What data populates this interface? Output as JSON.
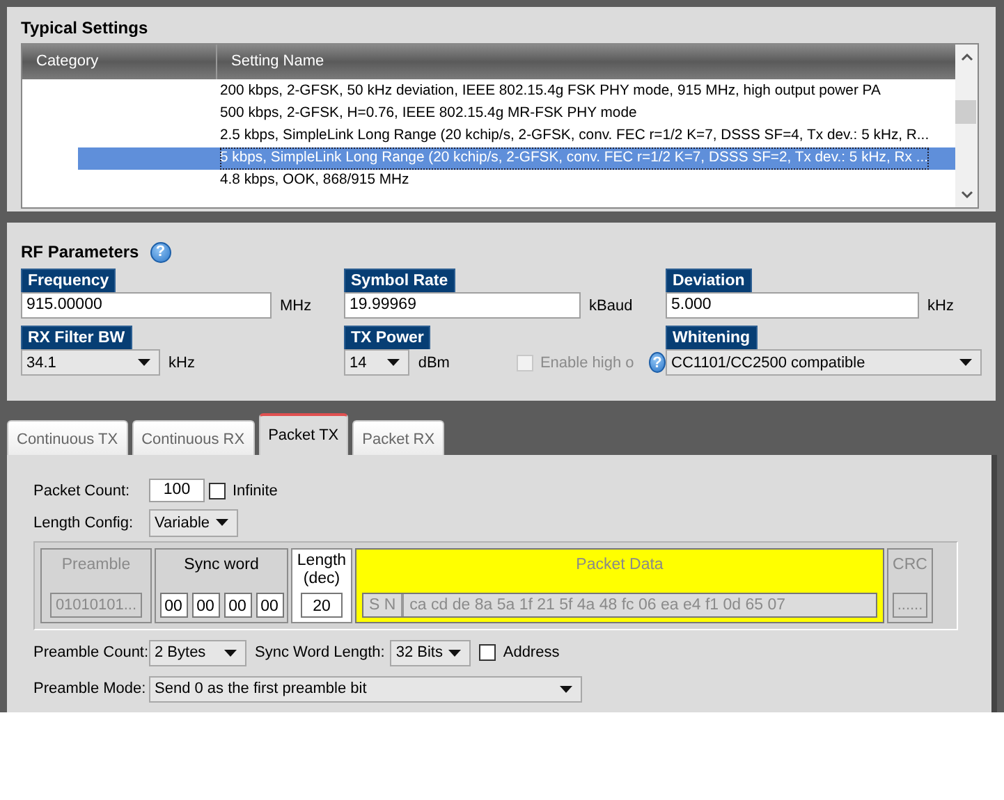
{
  "typical_settings": {
    "title": "Typical Settings",
    "columns": [
      "Category",
      "Setting Name"
    ],
    "rows": [
      {
        "name": "200 kbps, 2-GFSK, 50 kHz deviation, IEEE 802.15.4g FSK PHY mode, 915 MHz, high output power PA",
        "selected": false
      },
      {
        "name": "500 kbps, 2-GFSK, H=0.76, IEEE 802.15.4g MR-FSK PHY mode",
        "selected": false
      },
      {
        "name": "2.5 kbps, SimpleLink Long Range (20 kchip/s, 2-GFSK, conv. FEC r=1/2 K=7, DSSS SF=4, Tx dev.: 5 kHz, R...",
        "selected": false
      },
      {
        "name": "5 kbps, SimpleLink Long Range (20 kchip/s, 2-GFSK, conv. FEC r=1/2 K=7, DSSS SF=2, Tx dev.: 5 kHz, Rx ...",
        "selected": true
      },
      {
        "name": "4.8 kbps, OOK, 868/915 MHz",
        "selected": false
      }
    ]
  },
  "rf_parameters": {
    "title": "RF Parameters",
    "help": "?",
    "fields": [
      {
        "label": "Frequency",
        "kind": "input",
        "value": "915.00000",
        "unit": "MHz"
      },
      {
        "label": "Symbol Rate",
        "kind": "input",
        "value": "19.99969",
        "unit": "kBaud"
      },
      {
        "label": "Deviation",
        "kind": "input",
        "value": "5.000",
        "unit": "kHz"
      },
      {
        "label": "RX Filter BW",
        "kind": "select",
        "value": "34.1",
        "unit": "kHz"
      },
      {
        "label": "TX Power",
        "kind": "select",
        "value": "14",
        "unit": "dBm",
        "option": {
          "label": "Enable high o",
          "checked": false,
          "disabled": true
        },
        "help": "?"
      },
      {
        "label": "Whitening",
        "kind": "select",
        "value": "CC1101/CC2500 compatible"
      }
    ]
  },
  "tabs": [
    {
      "label": "Continuous TX",
      "selected": false
    },
    {
      "label": "Continuous RX",
      "selected": false
    },
    {
      "label": "Packet TX",
      "selected": true
    },
    {
      "label": "Packet RX",
      "selected": false
    }
  ],
  "packet_tx": {
    "packet_count": {
      "label": "Packet Count:",
      "value": "100"
    },
    "infinite": {
      "label": "Infinite",
      "checked": false
    },
    "length_config": {
      "label": "Length Config:",
      "value": "Variable"
    },
    "preamble": {
      "label": "Preamble",
      "value": "01010101...",
      "disabled": true
    },
    "sync_word": {
      "label": "Sync word",
      "bytes": [
        "00",
        "00",
        "00",
        "00"
      ]
    },
    "length": {
      "label": "Length (dec)",
      "value": "20"
    },
    "packet_data": {
      "label": "Packet Data",
      "prefix": "S N",
      "value": "ca cd de 8a 5a 1f 21 5f 4a 48 fc 06 ea e4 f1 0d 65 07",
      "disabled": true
    },
    "crc": {
      "label": "CRC",
      "value": "......",
      "disabled": true
    },
    "preamble_count": {
      "label": "Preamble Count:",
      "value": "2 Bytes"
    },
    "sync_word_length": {
      "label": "Sync Word Length:",
      "value": "32 Bits"
    },
    "address": {
      "label": "Address",
      "checked": false
    },
    "preamble_mode": {
      "label": "Preamble Mode:",
      "value": "Send 0 as the first preamble bit"
    }
  }
}
